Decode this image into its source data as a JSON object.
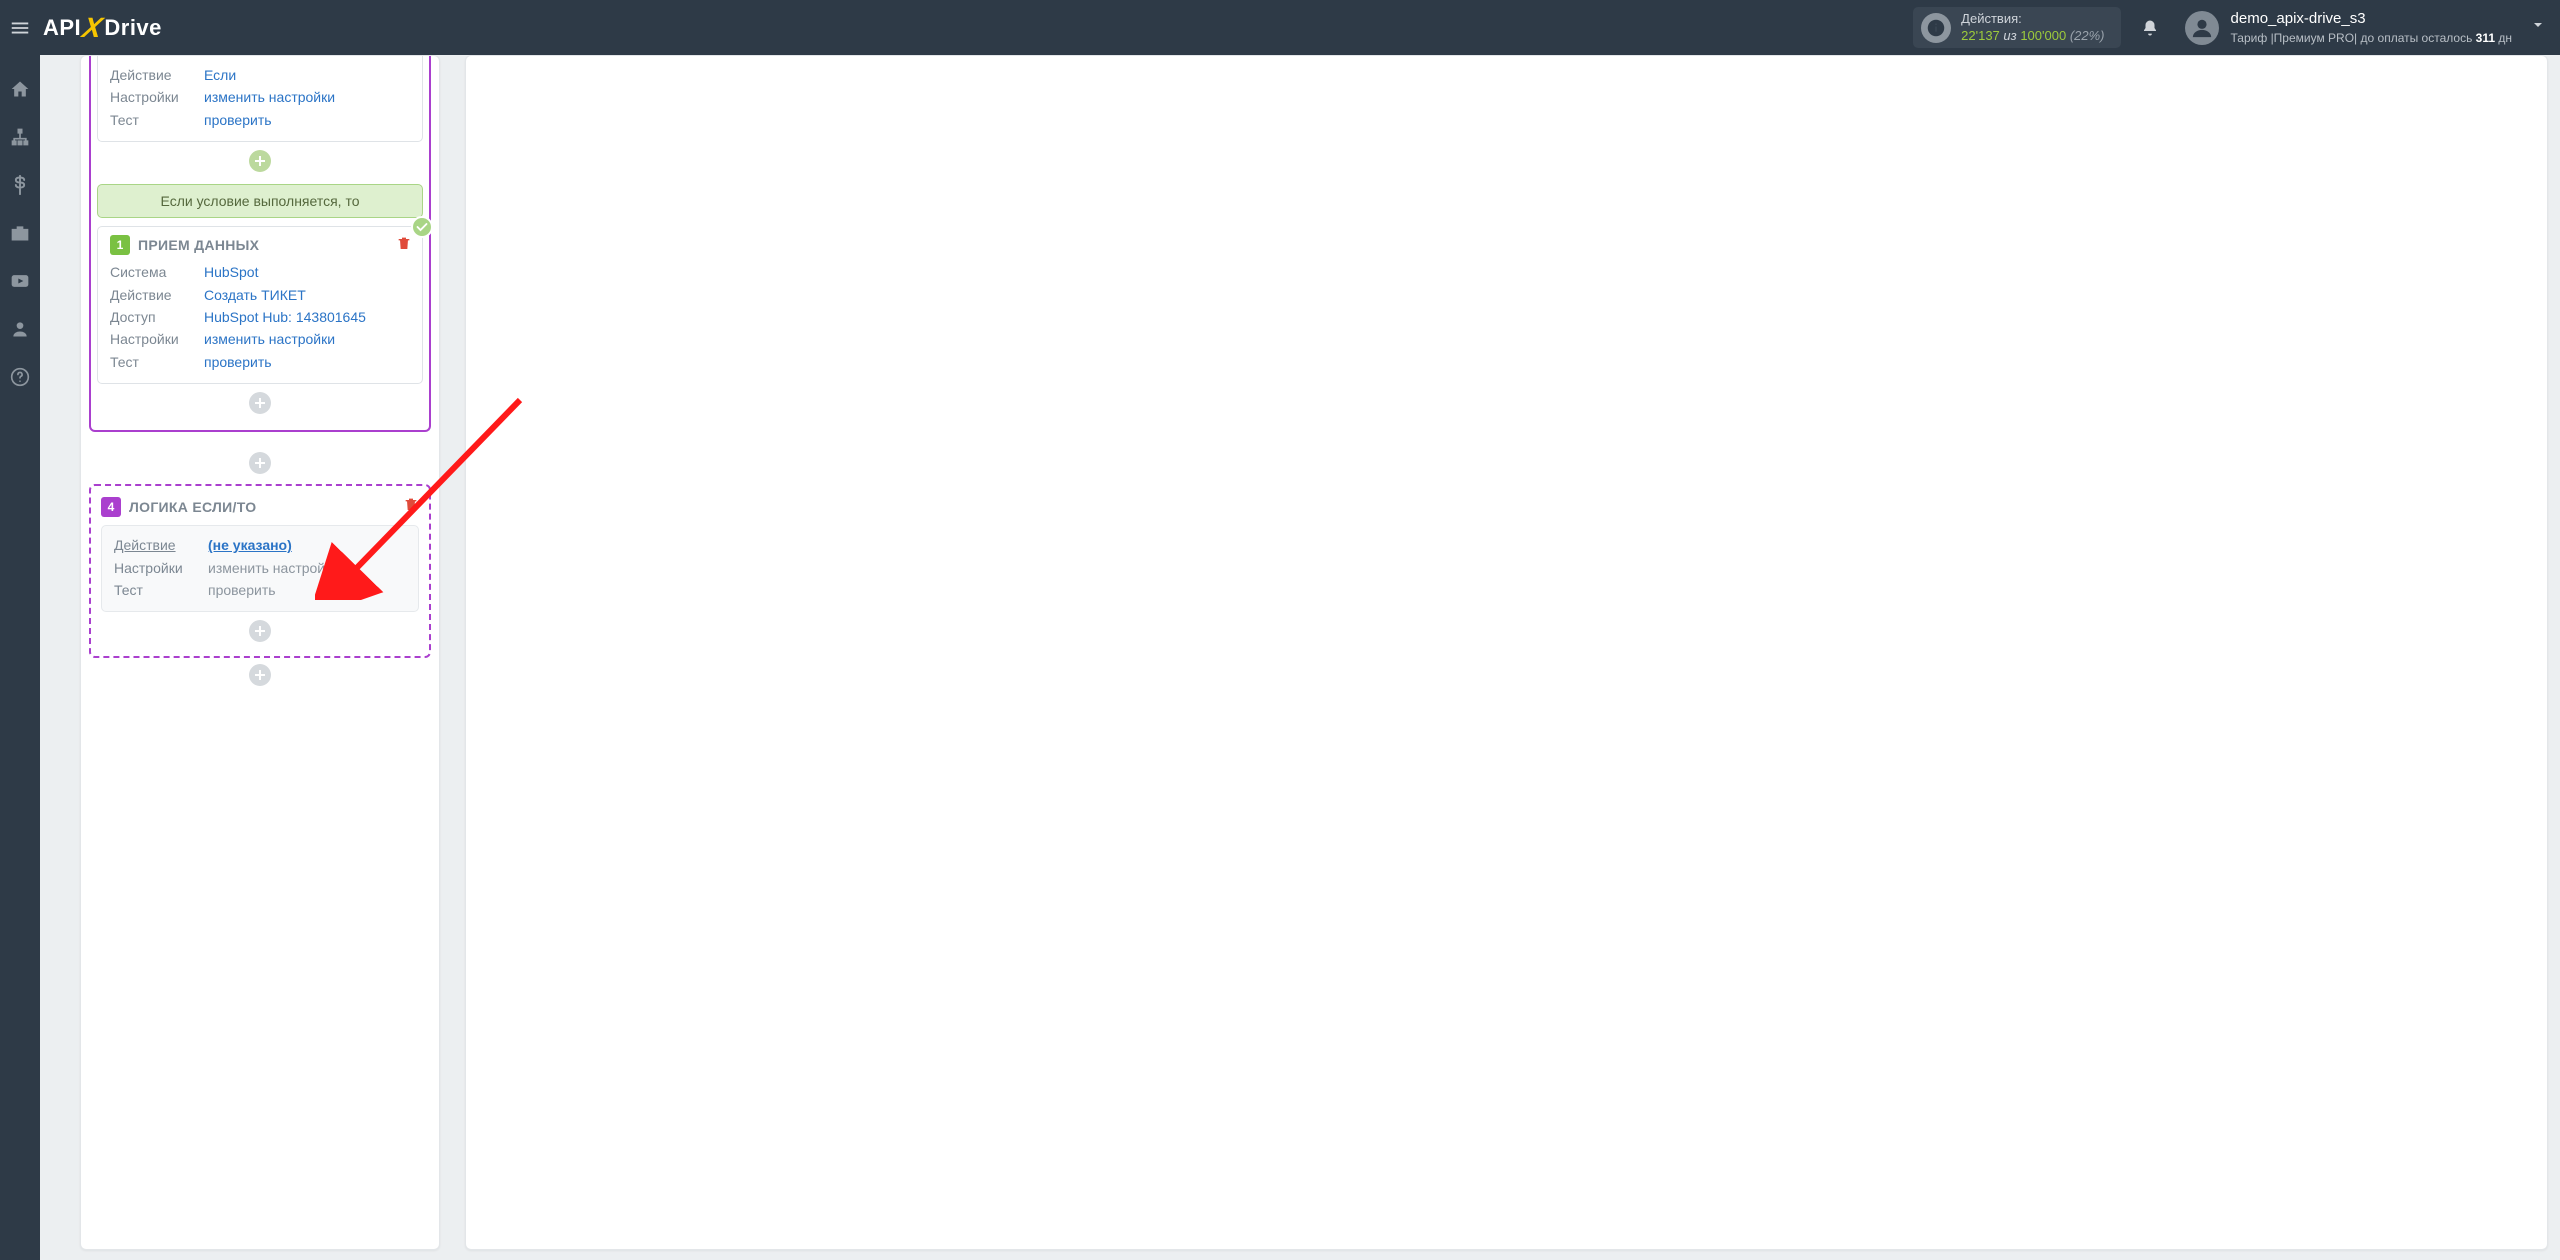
{
  "header": {
    "logo": {
      "part1": "API",
      "part2": "X",
      "part3": "Drive"
    },
    "actions": {
      "label": "Действия:",
      "used": "22'137",
      "of_word": "из",
      "total": "100'000",
      "percent": "(22%)"
    },
    "user": {
      "name": "demo_apix-drive_s3",
      "tariff_prefix": "Тариф |Премиум PRO| до оплаты осталось ",
      "days": "311",
      "days_suffix": " дн"
    }
  },
  "sidebar": {
    "items": [
      "home",
      "sitemap",
      "billing",
      "briefcase",
      "youtube",
      "profile",
      "help"
    ]
  },
  "flow": {
    "top_card": {
      "rows": [
        {
          "label": "Действие",
          "value": "Если"
        },
        {
          "label": "Настройки",
          "value": "изменить настройки"
        },
        {
          "label": "Тест",
          "value": "проверить"
        }
      ]
    },
    "condition_banner": "Если условие выполняется, то",
    "receive_block": {
      "number": "1",
      "title": "ПРИЕМ ДАННЫХ",
      "rows": [
        {
          "label": "Система",
          "value": "HubSpot"
        },
        {
          "label": "Действие",
          "value": "Создать ТИКЕТ"
        },
        {
          "label": "Доступ",
          "value": "HubSpot Hub: 143801645"
        },
        {
          "label": "Настройки",
          "value": "изменить настройки"
        },
        {
          "label": "Тест",
          "value": "проверить"
        }
      ]
    },
    "logic_block": {
      "number": "4",
      "title": "ЛОГИКА ЕСЛИ/ТО",
      "rows": [
        {
          "label": "Действие",
          "value": "(не указано)",
          "highlight": true
        },
        {
          "label": "Настройки",
          "value": "изменить настройки"
        },
        {
          "label": "Тест",
          "value": "проверить"
        }
      ]
    }
  }
}
